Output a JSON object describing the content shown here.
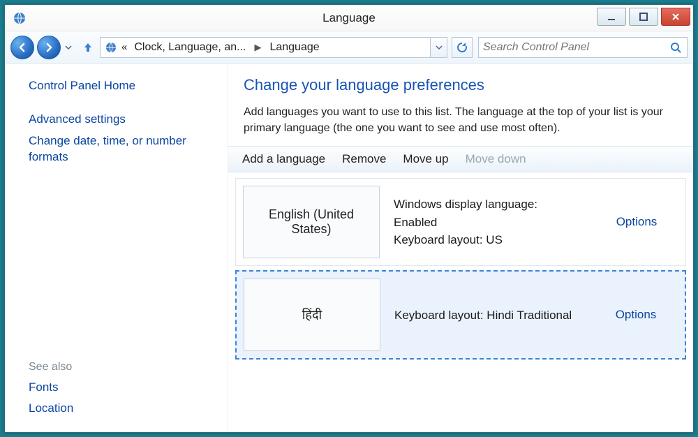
{
  "title": "Language",
  "breadcrumb": {
    "seg1": "Clock, Language, an...",
    "seg2": "Language"
  },
  "search": {
    "placeholder": "Search Control Panel"
  },
  "sidebar": {
    "home": "Control Panel Home",
    "advanced": "Advanced settings",
    "datetime": "Change date, time, or number formats",
    "see_also_label": "See also",
    "fonts": "Fonts",
    "location": "Location"
  },
  "main": {
    "heading": "Change your language preferences",
    "description": "Add languages you want to use to this list. The language at the top of your list is your primary language (the one you want to see and use most often)."
  },
  "toolbar": {
    "add": "Add a language",
    "remove": "Remove",
    "moveup": "Move up",
    "movedown": "Move down"
  },
  "languages": [
    {
      "tile": "English (United States)",
      "info_line1": "Windows display language: Enabled",
      "info_line2": "Keyboard layout: US",
      "options": "Options"
    },
    {
      "tile": "हिंदी",
      "info_line1": "Keyboard layout: Hindi Traditional",
      "info_line2": "",
      "options": "Options"
    }
  ]
}
